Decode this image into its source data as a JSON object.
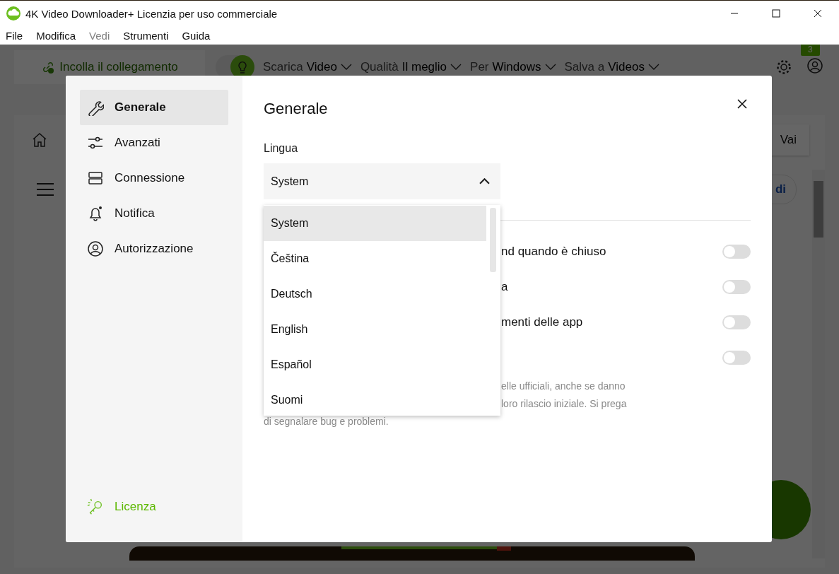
{
  "window": {
    "title": "4K Video Downloader+ Licenzia per uso commerciale"
  },
  "menu": [
    {
      "label": "File",
      "disabled": false
    },
    {
      "label": "Modifica",
      "disabled": false
    },
    {
      "label": "Vedi",
      "disabled": true
    },
    {
      "label": "Strumenti",
      "disabled": false
    },
    {
      "label": "Guida",
      "disabled": false
    }
  ],
  "toolbar": {
    "paste_link": "Incolla il collegamento",
    "smart_mode": {
      "on": true
    },
    "options": [
      {
        "label": "Scarica",
        "value": "Video"
      },
      {
        "label": "Qualità",
        "value": "Il meglio"
      },
      {
        "label": "Per",
        "value": "Windows"
      },
      {
        "label": "Salva a",
        "value": "Videos"
      }
    ],
    "badge": "3"
  },
  "search_bar": {
    "button": "Vai"
  },
  "link": "di",
  "dialog": {
    "sidebar": [
      {
        "label": "Generale",
        "kind": "wrench",
        "selected": true
      },
      {
        "label": "Avanzati",
        "kind": "sliders",
        "selected": false
      },
      {
        "label": "Connessione",
        "kind": "server",
        "selected": false
      },
      {
        "label": "Notifica",
        "kind": "bell",
        "selected": false
      },
      {
        "label": "Autorizzazione",
        "kind": "user",
        "selected": false
      }
    ],
    "license": "Licenza",
    "title": "Generale",
    "language": {
      "label": "Lingua",
      "value": "System",
      "expanded": true,
      "options": [
        {
          "label": "System",
          "selected": true
        },
        {
          "label": "Čeština",
          "selected": false
        },
        {
          "label": "Deutsch",
          "selected": false
        },
        {
          "label": "English",
          "selected": false
        },
        {
          "label": "Español",
          "selected": false
        },
        {
          "label": "Suomi",
          "selected": false
        }
      ]
    },
    "settings": [
      {
        "label": "nd quando è chiuso",
        "on": false
      },
      {
        "label": "a",
        "on": false
      },
      {
        "label": "menti delle app",
        "on": false
      },
      {
        "on": false
      }
    ],
    "note_lines": [
      "elle ufficiali, anche se danno",
      "loro rilascio iniziale. Si prega",
      "di segnalare bug e problemi."
    ]
  }
}
